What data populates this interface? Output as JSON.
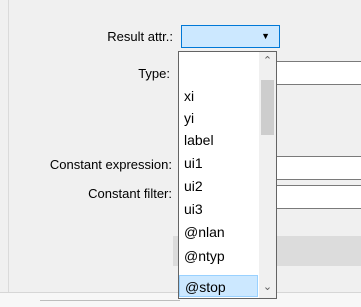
{
  "form": {
    "result_attr_label": "Result attr.:",
    "type_label": "Type:",
    "constant_expression_label": "Constant expression:",
    "constant_filter_label": "Constant filter:"
  },
  "dropdown": {
    "selected_value": "",
    "options": [
      "xi",
      "yi",
      "label",
      "ui1",
      "ui2",
      "ui3",
      "@nlan",
      "@ntyp",
      "@stop"
    ],
    "highlighted_option": "@stop"
  },
  "icons": {
    "combo_arrow": "▼",
    "scroll_up": "⌃",
    "scroll_down": "⌄"
  },
  "colors": {
    "selection_bg": "#cce8ff",
    "focus_border": "#0078d7"
  }
}
